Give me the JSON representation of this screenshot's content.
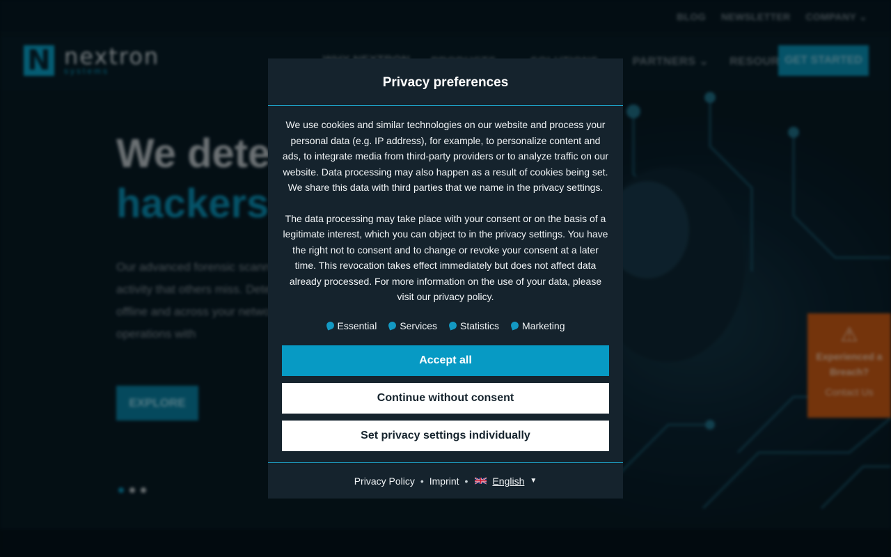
{
  "background": {
    "top_links": [
      "BLOG",
      "NEWSLETTER",
      "COMPANY"
    ],
    "logo": {
      "word": "nextron",
      "sub": "systems"
    },
    "nav": [
      "WHY NEXTRON",
      "PRODUCTS",
      "SOLUTIONS",
      "PARTNERS",
      "RESOURCES"
    ],
    "cta_label": "GET STARTED",
    "hero": {
      "title_line1": "We detect",
      "title_line2": "hackers",
      "text": "Our advanced forensic scanners detect hacker activity that others miss. Detect threats effectively offline and across your network to secure your operations with",
      "button_label": "EXPLORE"
    },
    "breach_tab": {
      "title": "Experienced a Breach?",
      "link": "Contact Us"
    }
  },
  "modal": {
    "title": "Privacy preferences",
    "paragraph1": "We use cookies and similar technologies on our website and process your personal data (e.g. IP address), for example, to personalize content and ads, to integrate media from third-party providers or to analyze traffic on our website. Data processing may also happen as a result of cookies being set. We share this data with third parties that we name in the privacy settings.",
    "paragraph2": "The data processing may take place with your consent or on the basis of a legitimate interest, which you can object to in the privacy settings. You have the right not to consent and to change or revoke your consent at a later time. This revocation takes effect immediately but does not affect data already processed. For more information on the use of your data, please visit our privacy policy.",
    "categories": [
      "Essential",
      "Services",
      "Statistics",
      "Marketing"
    ],
    "buttons": {
      "accept": "Accept all",
      "continue": "Continue without consent",
      "individual": "Set privacy settings individually"
    },
    "footer": {
      "privacy_policy": "Privacy Policy",
      "imprint": "Imprint",
      "separator": "•",
      "language": "English"
    },
    "colors": {
      "accent": "#079ac4",
      "panel": "#15232d"
    }
  }
}
